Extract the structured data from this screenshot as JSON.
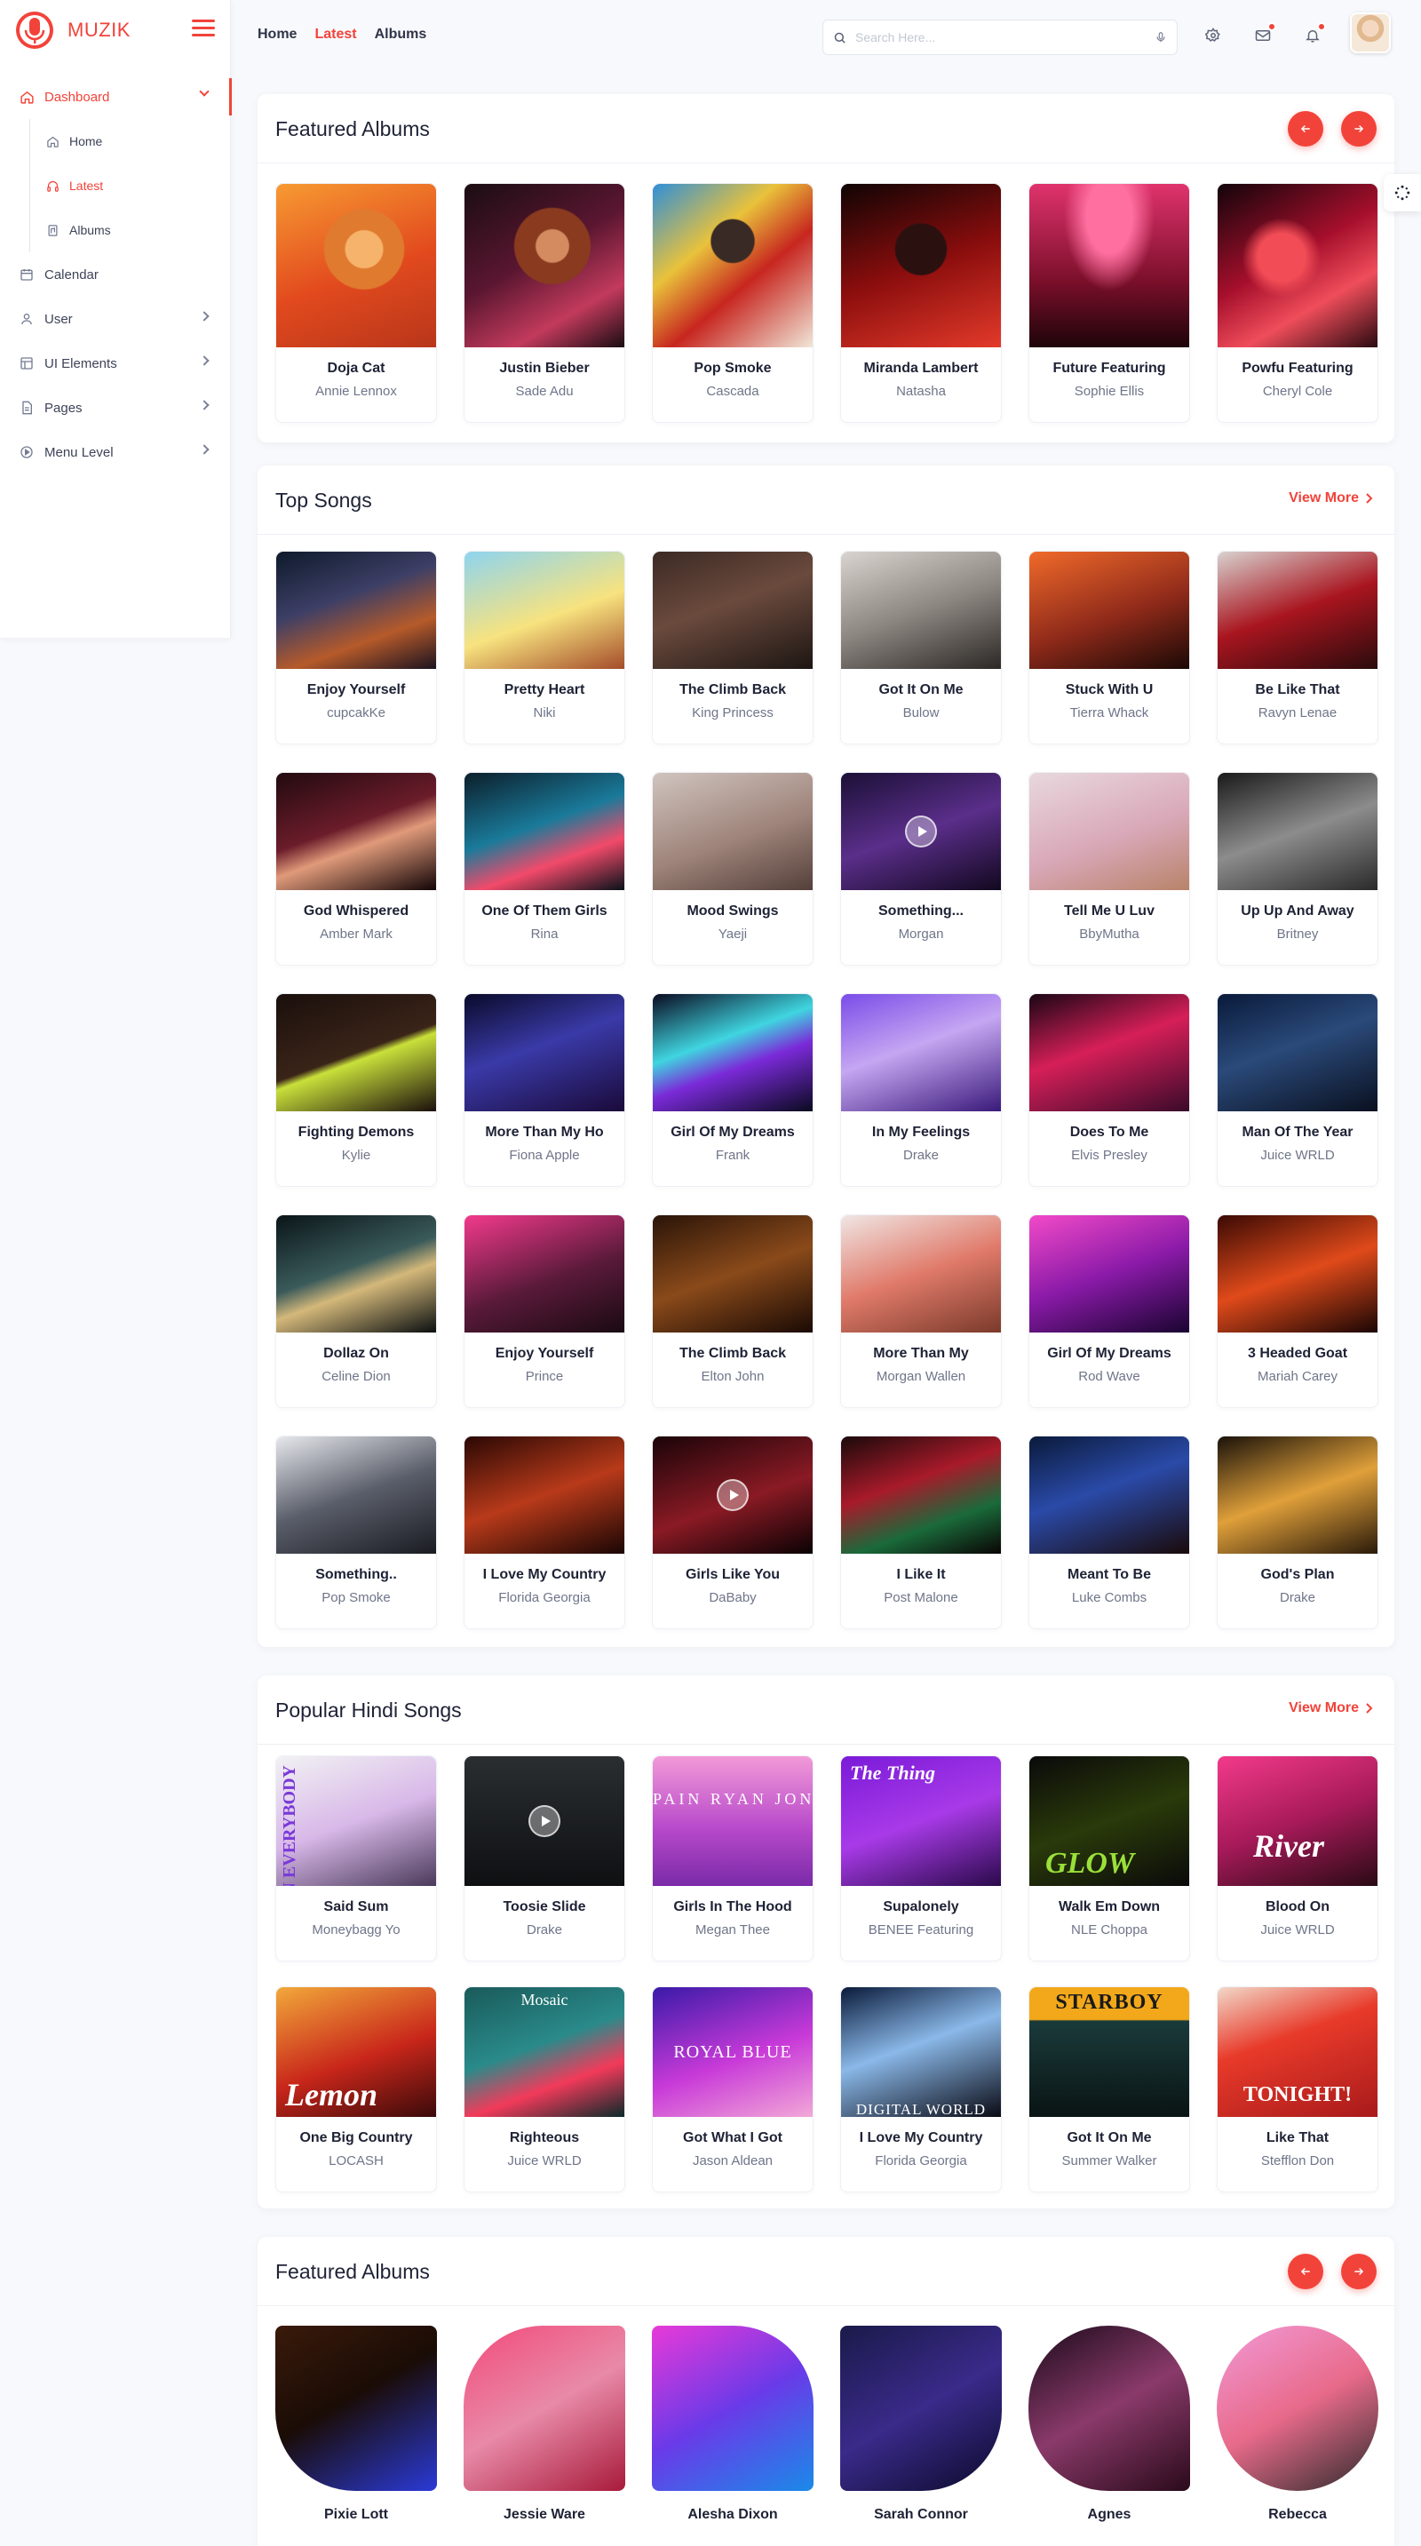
{
  "app": {
    "name": "MUZIK"
  },
  "sidebar": {
    "items": [
      {
        "label": "Dashboard"
      },
      {
        "label": "Calendar"
      },
      {
        "label": "User"
      },
      {
        "label": "UI Elements"
      },
      {
        "label": "Pages"
      },
      {
        "label": "Menu Level"
      }
    ],
    "sub_items": [
      {
        "label": "Home"
      },
      {
        "label": "Latest"
      },
      {
        "label": "Albums"
      }
    ]
  },
  "header": {
    "nav": [
      {
        "label": "Home"
      },
      {
        "label": "Latest"
      },
      {
        "label": "Albums"
      }
    ],
    "search_placeholder": "Search Here..."
  },
  "featured_albums": {
    "title": "Featured Albums",
    "items": [
      {
        "title": "Doja Cat",
        "artist": "Annie Lennox"
      },
      {
        "title": "Justin Bieber",
        "artist": "Sade Adu"
      },
      {
        "title": "Pop Smoke",
        "artist": "Cascada"
      },
      {
        "title": "Miranda Lambert",
        "artist": "Natasha"
      },
      {
        "title": "Future Featuring",
        "artist": "Sophie Ellis"
      },
      {
        "title": "Powfu Featuring",
        "artist": "Cheryl Cole"
      }
    ]
  },
  "top_songs": {
    "title": "Top Songs",
    "view_more": "View More",
    "items": [
      {
        "title": "Enjoy Yourself",
        "artist": "cupcakKe"
      },
      {
        "title": "Pretty Heart",
        "artist": "Niki"
      },
      {
        "title": "The Climb Back",
        "artist": "King Princess"
      },
      {
        "title": "Got It On Me",
        "artist": "Bulow"
      },
      {
        "title": "Stuck With U",
        "artist": "Tierra Whack"
      },
      {
        "title": "Be Like That",
        "artist": "Ravyn Lenae"
      },
      {
        "title": "God Whispered",
        "artist": "Amber Mark"
      },
      {
        "title": "One Of Them Girls",
        "artist": "Rina"
      },
      {
        "title": "Mood Swings",
        "artist": "Yaeji"
      },
      {
        "title": "Something...",
        "artist": "Morgan"
      },
      {
        "title": "Tell Me U Luv",
        "artist": "BbyMutha"
      },
      {
        "title": "Up Up And Away",
        "artist": "Britney"
      },
      {
        "title": "Fighting Demons",
        "artist": "Kylie"
      },
      {
        "title": "More Than My Ho",
        "artist": "Fiona Apple"
      },
      {
        "title": "Girl Of My Dreams",
        "artist": "Frank"
      },
      {
        "title": "In My Feelings",
        "artist": "Drake"
      },
      {
        "title": "Does To Me",
        "artist": "Elvis Presley"
      },
      {
        "title": "Man Of The Year",
        "artist": "Juice WRLD"
      },
      {
        "title": "Dollaz On",
        "artist": "Celine Dion"
      },
      {
        "title": "Enjoy Yourself",
        "artist": "Prince"
      },
      {
        "title": "The Climb Back",
        "artist": "Elton John"
      },
      {
        "title": "More Than My",
        "artist": "Morgan Wallen"
      },
      {
        "title": "Girl Of My Dreams",
        "artist": "Rod Wave"
      },
      {
        "title": "3 Headed Goat",
        "artist": "Mariah Carey"
      },
      {
        "title": "Something..",
        "artist": "Pop Smoke"
      },
      {
        "title": "I Love My Country",
        "artist": "Florida Georgia"
      },
      {
        "title": "Girls Like You",
        "artist": "DaBaby"
      },
      {
        "title": "I Like It",
        "artist": "Post Malone"
      },
      {
        "title": "Meant To Be",
        "artist": "Luke Combs"
      },
      {
        "title": "God's Plan",
        "artist": "Drake"
      }
    ]
  },
  "hindi_songs": {
    "title": "Popular Hindi Songs",
    "view_more": "View More",
    "items": [
      {
        "title": "Said Sum",
        "artist": "Moneybagg Yo",
        "art_text": "ON EVERYBODY"
      },
      {
        "title": "Toosie Slide",
        "artist": "Drake",
        "art_text": ""
      },
      {
        "title": "Girls In The Hood",
        "artist": "Megan Thee",
        "art_text": "PAIN RYAN JONES"
      },
      {
        "title": "Supalonely",
        "artist": "BENEE Featuring",
        "art_text": "The Thing"
      },
      {
        "title": "Walk Em Down",
        "artist": "NLE Choppa",
        "art_text": "GLOW"
      },
      {
        "title": "Blood On",
        "artist": "Juice WRLD",
        "art_text": "River"
      },
      {
        "title": "One Big Country",
        "artist": "LOCASH",
        "art_text": "Lemon"
      },
      {
        "title": "Righteous",
        "artist": "Juice WRLD",
        "art_text": "Mosaic"
      },
      {
        "title": "Got What I Got",
        "artist": "Jason Aldean",
        "art_text": "ROYAL BLUE"
      },
      {
        "title": "I Love My Country",
        "artist": "Florida Georgia",
        "art_text": "DIGITAL WORLD"
      },
      {
        "title": "Got It On Me",
        "artist": "Summer Walker",
        "art_text": "STARBOY"
      },
      {
        "title": "Like That",
        "artist": "Stefflon Don",
        "art_text": "TONIGHT!"
      }
    ]
  },
  "featured_albums_2": {
    "title": "Featured Albums",
    "items": [
      {
        "title": "Pixie Lott"
      },
      {
        "title": "Jessie Ware"
      },
      {
        "title": "Alesha Dixon"
      },
      {
        "title": "Sarah Connor"
      },
      {
        "title": "Agnes"
      },
      {
        "title": "Rebecca"
      }
    ]
  },
  "colors": {
    "accent": "#f2433a",
    "background": "#f8f9fc"
  }
}
